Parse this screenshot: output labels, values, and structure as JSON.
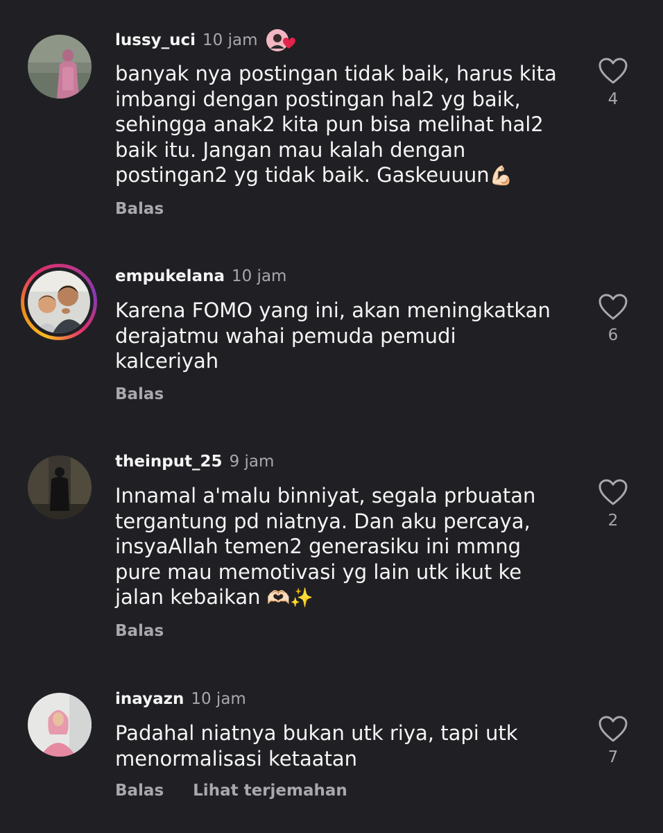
{
  "comments": [
    {
      "username": "lussy_uci",
      "time": "10 jam",
      "text": "banyak nya postingan tidak baik, harus kita\nimbangi dengan postingan hal2 yg baik,\nsehingga anak2 kita pun bisa melihat hal2\nbaik itu. Jangan mau kalah dengan\npostingan2 yg tidak baik. Gaskeuuun",
      "emoji": "💪🏻",
      "like_count": "4",
      "reply_label": "Balas",
      "badge_icon": "heart-badge-icon"
    },
    {
      "username": "empukelana",
      "time": "10 jam",
      "text": "Karena FOMO yang ini, akan meningkatkan\nderajatmu wahai pemuda pemudi\nkalceriyah",
      "emoji": "",
      "like_count": "6",
      "reply_label": "Balas"
    },
    {
      "username": "theinput_25",
      "time": "9 jam",
      "text": "Innamal a'malu binniyat, segala prbuatan\ntergantung pd niatnya. Dan aku percaya,\ninsyaAllah temen2 generasiku ini mmng\npure mau memotivasi yg lain utk ikut ke\njalan kebaikan ",
      "emoji": "🫶🏻✨",
      "like_count": "2",
      "reply_label": "Balas"
    },
    {
      "username": "inayazn",
      "time": "10 jam",
      "text": "Padahal niatnya bukan utk riya, tapi utk\nmenormalisasi ketaatan",
      "emoji": "",
      "like_count": "7",
      "reply_label": "Balas",
      "translate_label": "Lihat terjemahan"
    }
  ],
  "colors": {
    "background": "#202024",
    "primary_text": "#f5f5f5",
    "secondary_text": "#a8a8ad",
    "badge_heart": "#e0244a"
  }
}
